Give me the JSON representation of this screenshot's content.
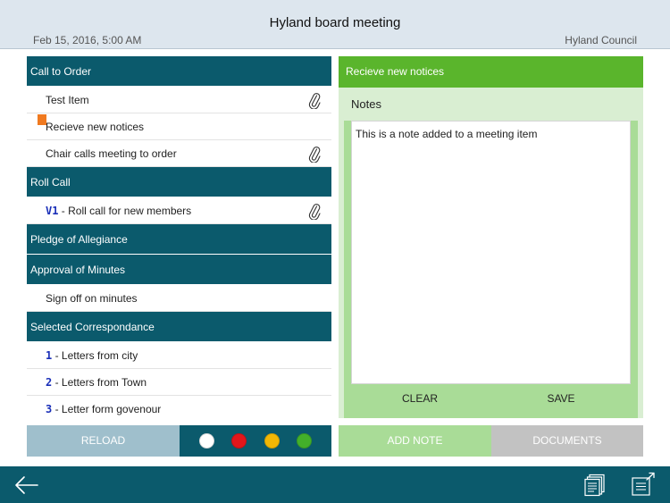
{
  "header": {
    "title": "Hyland board meeting",
    "date": "Feb 15, 2016, 5:00 AM",
    "organization": "Hyland Council"
  },
  "agenda": {
    "sections": [
      {
        "title": "Call to Order",
        "items": [
          {
            "number": "",
            "label": "Test Item",
            "attachment": true,
            "flag": false
          },
          {
            "number": "",
            "label": "Recieve new notices",
            "attachment": false,
            "flag": true
          },
          {
            "number": "",
            "label": "Chair calls meeting to order",
            "attachment": true,
            "flag": false
          }
        ]
      },
      {
        "title": "Roll Call",
        "items": [
          {
            "number": "V1",
            "label": " - Roll call for new members",
            "attachment": true,
            "flag": false
          }
        ]
      },
      {
        "title": "Pledge of Allegiance",
        "items": []
      },
      {
        "title": "Approval of Minutes",
        "items": [
          {
            "number": "",
            "label": "Sign off on minutes",
            "attachment": false,
            "flag": false
          }
        ]
      },
      {
        "title": "Selected Correspondance",
        "items": [
          {
            "number": "1",
            "label": " - Letters from city",
            "attachment": false,
            "flag": false
          },
          {
            "number": "2",
            "label": " - Letters from Town",
            "attachment": false,
            "flag": false
          },
          {
            "number": "3",
            "label": " - Letter form govenour",
            "attachment": false,
            "flag": false
          }
        ]
      }
    ]
  },
  "toolbar": {
    "reload_label": "RELOAD",
    "colors": [
      {
        "name": "white",
        "hex": "#ffffff"
      },
      {
        "name": "red",
        "hex": "#e3161b"
      },
      {
        "name": "yellow",
        "hex": "#f2b705"
      },
      {
        "name": "green",
        "hex": "#43b02a"
      }
    ]
  },
  "notes_panel": {
    "header": "Recieve new notices",
    "label": "Notes",
    "text": "This is a note added to a meeting item",
    "clear_label": "CLEAR",
    "save_label": "SAVE"
  },
  "actions": {
    "add_note_label": "ADD NOTE",
    "documents_label": "DOCUMENTS"
  },
  "bottom_bar": {
    "icons": [
      "back-arrow-icon",
      "documents-stack-icon",
      "share-export-icon"
    ]
  },
  "theme": {
    "section_color": "#0b5a6c",
    "accent_green": "#5ab52c",
    "light_green": "#a9dc97",
    "flag_color": "#f07a20",
    "number_color": "#1a2fb8"
  }
}
